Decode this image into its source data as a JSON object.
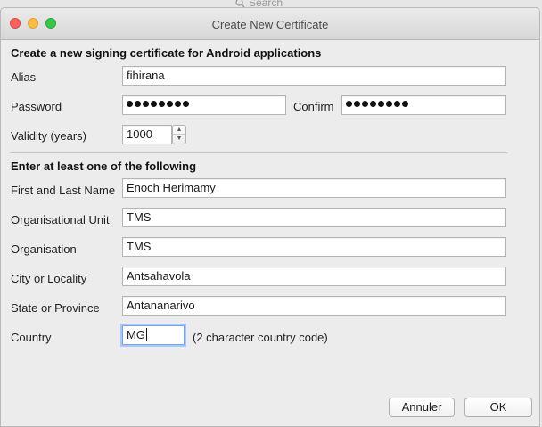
{
  "search": {
    "placeholder": "Search"
  },
  "window": {
    "title": "Create New Certificate"
  },
  "signing": {
    "heading": "Create a new signing certificate for Android applications",
    "alias_label": "Alias",
    "alias_value": "fihirana",
    "password_label": "Password",
    "confirm_label": "Confirm",
    "validity_label": "Validity (years)",
    "validity_value": "1000"
  },
  "details": {
    "heading": "Enter at least one of the following",
    "name_label": "First and Last Name",
    "name_value": "Enoch Herimamy",
    "unit_label": "Organisational Unit",
    "unit_value": "TMS",
    "org_label": "Organisation",
    "org_value": "TMS",
    "city_label": "City or Locality",
    "city_value": "Antsahavola",
    "state_label": "State or Province",
    "state_value": "Antananarivo",
    "country_label": "Country",
    "country_value": "MG",
    "country_hint": "(2 character country code)"
  },
  "buttons": {
    "cancel": "Annuler",
    "ok": "OK"
  },
  "icons": {
    "search": "search-icon",
    "stepper_up": "chevron-up-icon",
    "stepper_down": "chevron-down-icon"
  },
  "colors": {
    "close": "#fc605c",
    "minimize": "#fdbc40",
    "maximize": "#34c84a",
    "focus_ring": "#6fa6ef"
  }
}
